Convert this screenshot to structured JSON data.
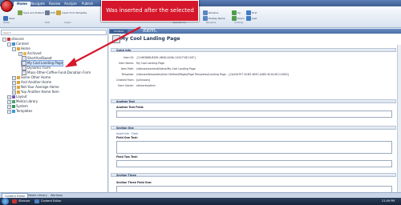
{
  "ribbon": {
    "tabs": [
      "Home",
      "Navigate",
      "Review",
      "Analyze",
      "Publish"
    ],
    "buttons": {
      "save": "Save",
      "save_publish": "Save and Publish",
      "edit": "Edit",
      "insert_template": "Insert from Template",
      "rename": "Rename",
      "display_name": "Display Name",
      "up": "Up",
      "down": "Down",
      "first": "First",
      "last": "Last"
    },
    "groups": [
      "Write",
      "Edit",
      "Insert",
      "Operations",
      "Rename",
      "Sorting"
    ]
  },
  "callout": {
    "text": "Was inserted after the selected item."
  },
  "tree": {
    "search_placeholder": "Search",
    "nodes": [
      {
        "label": "sitecore",
        "level": 0
      },
      {
        "label": "Content",
        "level": 1
      },
      {
        "label": "Home",
        "level": 2
      },
      {
        "label": "Archived",
        "level": 3
      },
      {
        "label": "ShortAndSweet",
        "level": 3
      },
      {
        "label": "My Cool Landing Page",
        "level": 3
      },
      {
        "label": "Dynamic Form",
        "level": 3
      },
      {
        "label": "Mass-Other-Coffee-Fund-Donation Form",
        "level": 3
      },
      {
        "label": "Some Other Home",
        "level": 2
      },
      {
        "label": "And Another Home",
        "level": 2
      },
      {
        "label": "Not Your Average Home",
        "level": 2
      },
      {
        "label": "Yup Another Home Item",
        "level": 2
      },
      {
        "label": "Layout",
        "level": 1
      },
      {
        "label": "Media Library",
        "level": 1
      },
      {
        "label": "System",
        "level": 1
      },
      {
        "label": "Templates",
        "level": 1
      }
    ]
  },
  "editor": {
    "tab": "Content",
    "item_title": "My Cool Landing Page",
    "quick_info": {
      "header": "Quick Info",
      "rows": [
        {
          "label": "Item ID:",
          "value": "{11963888-B565-4B4D-A09A-1434774E110F}"
        },
        {
          "label": "Item Name:",
          "value": "My Cool Landing Page"
        },
        {
          "label": "Item Path:",
          "value": "/sitecore/content/Home/My Cool Landing Page"
        },
        {
          "label": "Template:",
          "value": "/sitecore/templates/User Defined/Pages/Page Templates/Landing Page - {2A43A7E7-D1B3-4B3C-A4B3-6CA14E1110D0}"
        },
        {
          "label": "Created From:",
          "value": "[unknown]"
        },
        {
          "label": "Item Owner:",
          "value": "sitecore\\admin"
        }
      ]
    },
    "sections": [
      {
        "header": "Another Test",
        "field_label": "Another Text Field:"
      },
      {
        "header": "Section One",
        "links": "Insert link · Clear",
        "field_label": "Field One Text:",
        "field_label2": "Field Two Text:"
      },
      {
        "header": "Section Three",
        "field_label": "Section Three Field One:"
      }
    ]
  },
  "bottom_tabs": [
    "Content Editor",
    "Media Library",
    "Workbox"
  ],
  "taskbar": {
    "items": [
      "Sitecore",
      "Content Editor"
    ],
    "clock": "21:09 PM"
  }
}
